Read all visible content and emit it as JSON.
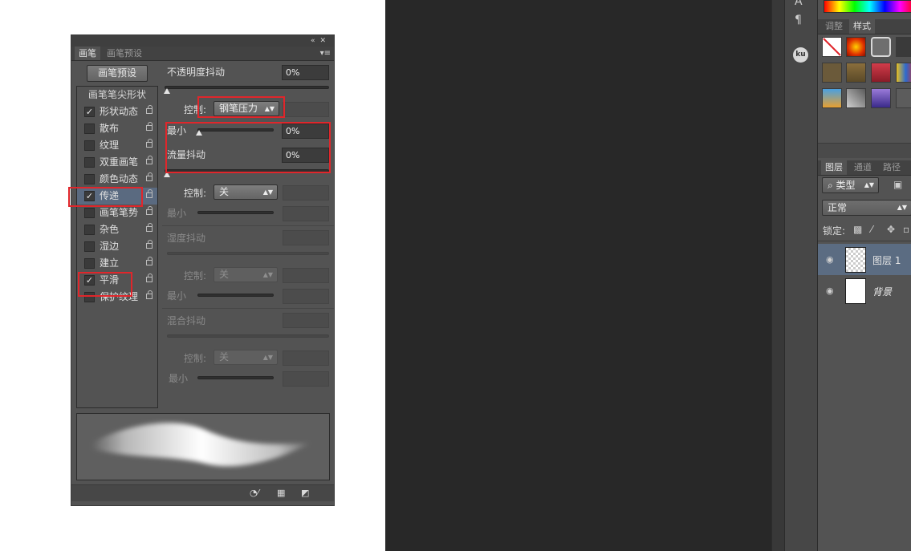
{
  "brush_panel": {
    "tabs": [
      "画笔",
      "画笔预设"
    ],
    "preset_button": "画笔预设",
    "list_header": "画笔笔尖形状",
    "items": [
      {
        "label": "形状动态",
        "checked": true
      },
      {
        "label": "散布",
        "checked": false
      },
      {
        "label": "纹理",
        "checked": false
      },
      {
        "label": "双重画笔",
        "checked": false
      },
      {
        "label": "颜色动态",
        "checked": false
      },
      {
        "label": "传递",
        "checked": true,
        "selected": true
      },
      {
        "label": "画笔笔势",
        "checked": false
      },
      {
        "label": "杂色",
        "checked": false
      },
      {
        "label": "湿边",
        "checked": false
      },
      {
        "label": "建立",
        "checked": false
      },
      {
        "label": "平滑",
        "checked": true
      },
      {
        "label": "保护纹理",
        "checked": false
      }
    ],
    "check_mark": "✓",
    "opacity_jitter": {
      "label": "不透明度抖动",
      "value": "0%"
    },
    "control_label": "控制:",
    "opacity_control": {
      "value": "钢笔压力"
    },
    "min_label": "最小",
    "opacity_min": {
      "value": "0%"
    },
    "flow_jitter": {
      "label": "流量抖动",
      "value": "0%"
    },
    "flow_control": {
      "value": "关"
    },
    "wetness_jitter": {
      "label": "湿度抖动"
    },
    "wetness_control": {
      "value": "关"
    },
    "mix_jitter": {
      "label": "混合抖动"
    },
    "mix_control": {
      "value": "关"
    }
  },
  "dock": {
    "para_icon": "¶",
    "ku_label": "ku"
  },
  "right_panel": {
    "style_tabs": [
      "调整",
      "样式"
    ],
    "layer_tabs": [
      "图层",
      "通道",
      "路径"
    ],
    "filter_type": "类型",
    "blend_mode": "正常",
    "lock_label": "锁定:",
    "layers": [
      {
        "name": "图层 1",
        "selected": true,
        "transparent": true
      },
      {
        "name": "背景",
        "selected": false,
        "transparent": false
      }
    ]
  },
  "colors": {
    "accent_red": "#e0262b",
    "panel_bg": "#535353",
    "canvas_bg": "#282828",
    "selection_blue": "#5a6a80"
  }
}
